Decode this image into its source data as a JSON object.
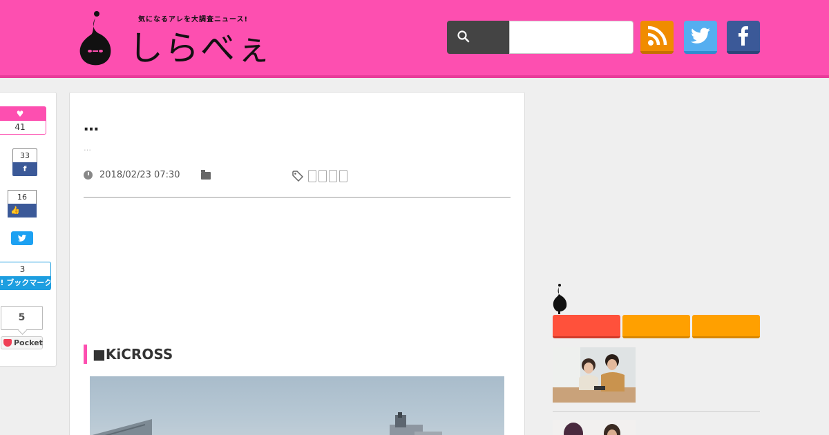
{
  "header": {
    "logo_tagline": "気になるアレを大調査ニュース!",
    "logo_text": "しらべぇ",
    "search": {
      "value": "",
      "placeholder": ""
    },
    "sns": [
      {
        "name": "rss-icon",
        "color": "#f08c00"
      },
      {
        "name": "twitter-icon",
        "color": "#55aef0"
      },
      {
        "name": "facebook-icon",
        "color": "#3b5998"
      }
    ],
    "brand_color": "#fd4fb0"
  },
  "share": {
    "like_count": "41",
    "fb_share_count": "33",
    "fb_like_count": "16",
    "hatena_count": "3",
    "hatena_label": "B! ブックマーク",
    "pocket_count": "5",
    "pocket_label": "Pocket"
  },
  "article": {
    "title": "…",
    "subtitle": "…",
    "date": "2018/02/23 07:30",
    "category": "",
    "tags": [
      "",
      "",
      "",
      ""
    ],
    "section_heading": "■KiCROSS"
  },
  "sidebar": {
    "tabs": [
      "",
      "",
      ""
    ],
    "tab_colors": [
      "#ff513b",
      "#ffa000",
      "#ffa000"
    ]
  }
}
